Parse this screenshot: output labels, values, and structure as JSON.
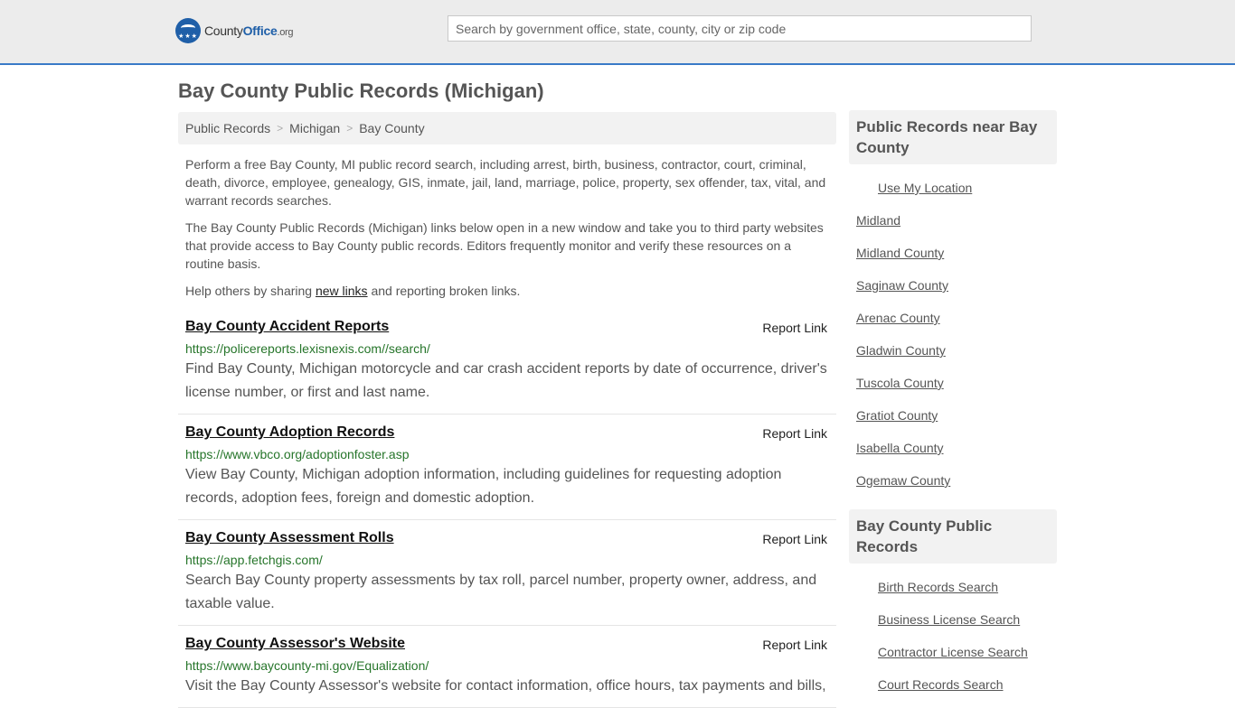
{
  "header": {
    "logo_main": "County",
    "logo_brand": "Office",
    "logo_suffix": ".org",
    "search_placeholder": "Search by government office, state, county, city or zip code"
  },
  "page": {
    "title": "Bay County Public Records (Michigan)"
  },
  "breadcrumb": [
    {
      "label": "Public Records"
    },
    {
      "label": "Michigan"
    },
    {
      "label": "Bay County"
    }
  ],
  "intro": {
    "p1": "Perform a free Bay County, MI public record search, including arrest, birth, business, contractor, court, criminal, death, divorce, employee, genealogy, GIS, inmate, jail, land, marriage, police, property, sex offender, tax, vital, and warrant records searches.",
    "p2": "The Bay County Public Records (Michigan) links below open in a new window and take you to third party websites that provide access to Bay County public records. Editors frequently monitor and verify these resources on a routine basis.",
    "p3_before": "Help others by sharing ",
    "p3_link": "new links",
    "p3_after": " and reporting broken links."
  },
  "report_label": "Report Link",
  "records": [
    {
      "title": "Bay County Accident Reports",
      "url": "https://policereports.lexisnexis.com//search/",
      "desc": "Find Bay County, Michigan motorcycle and car crash accident reports by date of occurrence, driver's license number, or first and last name."
    },
    {
      "title": "Bay County Adoption Records",
      "url": "https://www.vbco.org/adoptionfoster.asp",
      "desc": "View Bay County, Michigan adoption information, including guidelines for requesting adoption records, adoption fees, foreign and domestic adoption."
    },
    {
      "title": "Bay County Assessment Rolls",
      "url": "https://app.fetchgis.com/",
      "desc": "Search Bay County property assessments by tax roll, parcel number, property owner, address, and taxable value."
    },
    {
      "title": "Bay County Assessor's Website",
      "url": "https://www.baycounty-mi.gov/Equalization/",
      "desc": "Visit the Bay County Assessor's website for contact information, office hours, tax payments and bills,"
    }
  ],
  "sidebar": {
    "nearby_title": "Public Records near Bay County",
    "use_location": "Use My Location",
    "nearby": [
      "Midland",
      "Midland County",
      "Saginaw County",
      "Arenac County",
      "Gladwin County",
      "Tuscola County",
      "Gratiot County",
      "Isabella County",
      "Ogemaw County"
    ],
    "county_title": "Bay County Public Records",
    "county_links": [
      "Birth Records Search",
      "Business License Search",
      "Contractor License Search",
      "Court Records Search"
    ]
  }
}
